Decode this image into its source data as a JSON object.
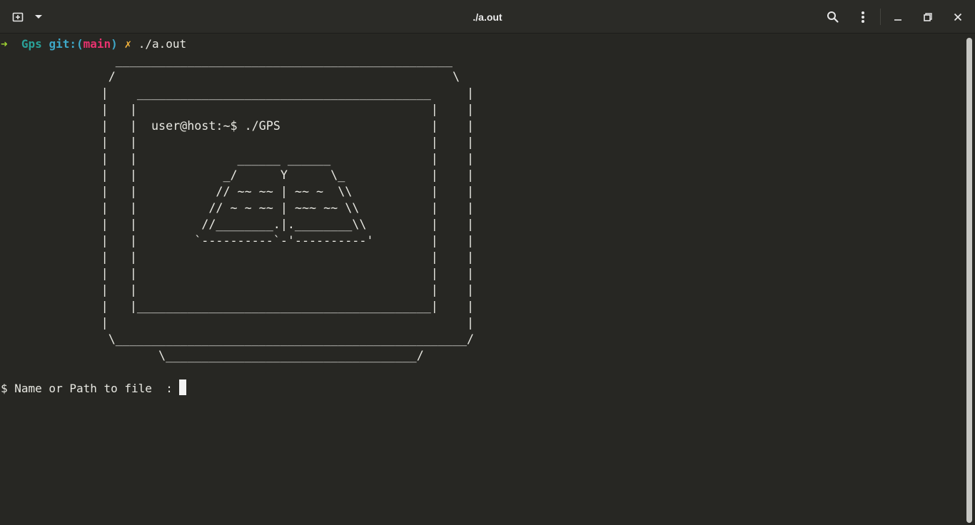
{
  "window": {
    "title": "./a.out",
    "icons": {
      "new_tab": "new-tab-icon",
      "menu_dropdown": "chevron-down-icon",
      "search": "search-icon",
      "more": "kebab-menu-icon",
      "minimize": "minimize-icon",
      "restore": "restore-icon",
      "close": "close-icon"
    }
  },
  "terminal": {
    "prompt": {
      "arrow": "➜",
      "directory": "Gps",
      "git_prefix": "git:(",
      "branch": "main",
      "git_suffix": ")",
      "dirty_marker": "✗",
      "command": "./a.out"
    },
    "ascii_art": "                _______________________________________________\n               /                                               \\\n              |    _________________________________________     |\n              |   |                                         |    |\n              |   |  user@host:~$ ./GPS                     |    |\n              |   |                                         |    |\n              |   |              ______ ______              |    |\n              |   |            _/      Y      \\_            |    |\n              |   |           // ~~ ~~ | ~~ ~  \\\\           |    |\n              |   |          // ~ ~ ~~ | ~~~ ~~ \\\\          |    |\n              |   |         //________.|.________\\\\         |    |\n              |   |        `----------`-'----------'        |    |\n              |   |                                         |    |\n              |   |                                         |    |\n              |   |                                         |    |\n              |   |_________________________________________|    |\n              |                                                  |\n               \\_________________________________________________/\n                      \\___________________________________/",
    "input_prompt": "$ Name or Path to file  : ",
    "colors": {
      "background": "#272723",
      "foreground": "#e8e8e2",
      "arrow": "#9fd233",
      "directory": "#2aa198",
      "git": "#3ea8c8",
      "branch": "#e8326f",
      "dirty": "#f2b33d"
    }
  }
}
